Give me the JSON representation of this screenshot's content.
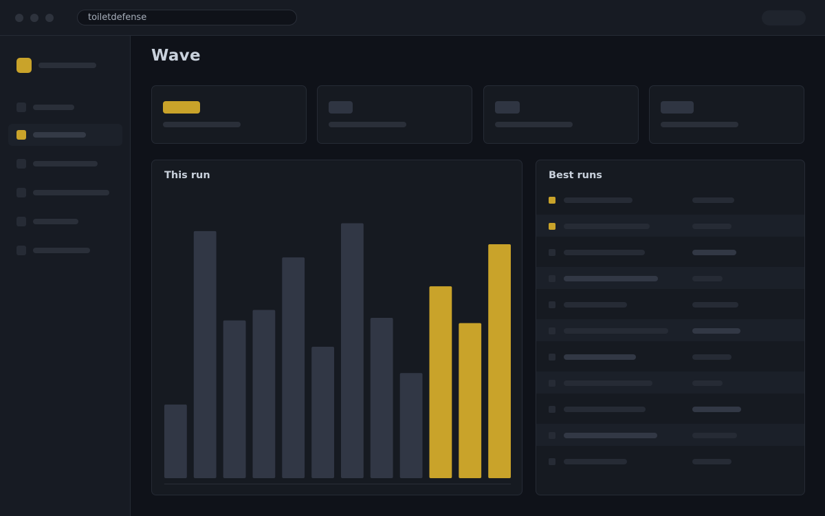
{
  "browser": {
    "url": "toiletdefense"
  },
  "page": {
    "title": "Wave"
  },
  "colors": {
    "accent": "#c9a32a",
    "bar_default": "#313745",
    "placeholder": "#2a2f39"
  },
  "sidebar": {
    "active_index": 1,
    "item_count": 6
  },
  "chart_panel": {
    "title": "This run"
  },
  "list_panel": {
    "title": "Best runs",
    "highlighted_rows": [
      0,
      1
    ],
    "row_count": 11
  },
  "chart_data": {
    "type": "bar",
    "title": "This run",
    "xlabel": "",
    "ylabel": "",
    "ylim": [
      0,
      100
    ],
    "values": [
      28,
      94,
      60,
      64,
      84,
      50,
      97,
      61,
      40,
      73,
      59,
      89
    ],
    "highlighted": [
      false,
      false,
      false,
      false,
      false,
      false,
      false,
      false,
      false,
      true,
      true,
      true
    ]
  }
}
